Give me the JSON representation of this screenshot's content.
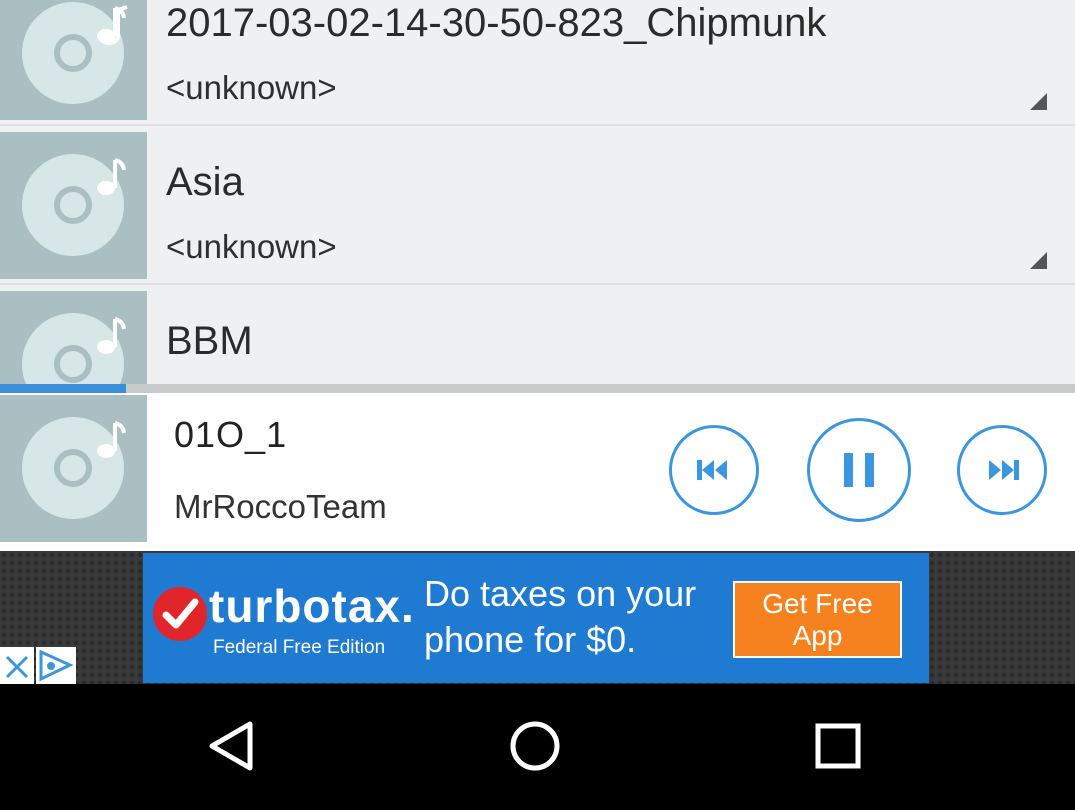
{
  "songs": [
    {
      "title": "2017-03-02-14-30-50-823_Chipmunk",
      "artist": "<unknown>"
    },
    {
      "title": "Asia",
      "artist": "<unknown>"
    },
    {
      "title": "BBM",
      "artist": ""
    }
  ],
  "playback": {
    "progress_fraction": 0.117
  },
  "now_playing": {
    "title": "01O_1",
    "artist": "MrRoccoTeam"
  },
  "ad": {
    "brand": "turbotax.",
    "edition": "Federal Free Edition",
    "headline": "Do taxes on your phone for $0.",
    "cta": "Get Free App"
  },
  "colors": {
    "accent": "#3b96e0",
    "art_bg": "#a9bfc1",
    "ad_blue": "#1f7ad1",
    "ad_orange": "#f5821f"
  },
  "icons": [
    "music-disc-icon",
    "previous-icon",
    "pause-icon",
    "next-icon",
    "close-icon",
    "ad-choices-icon",
    "back-icon",
    "home-icon",
    "recents-icon"
  ]
}
